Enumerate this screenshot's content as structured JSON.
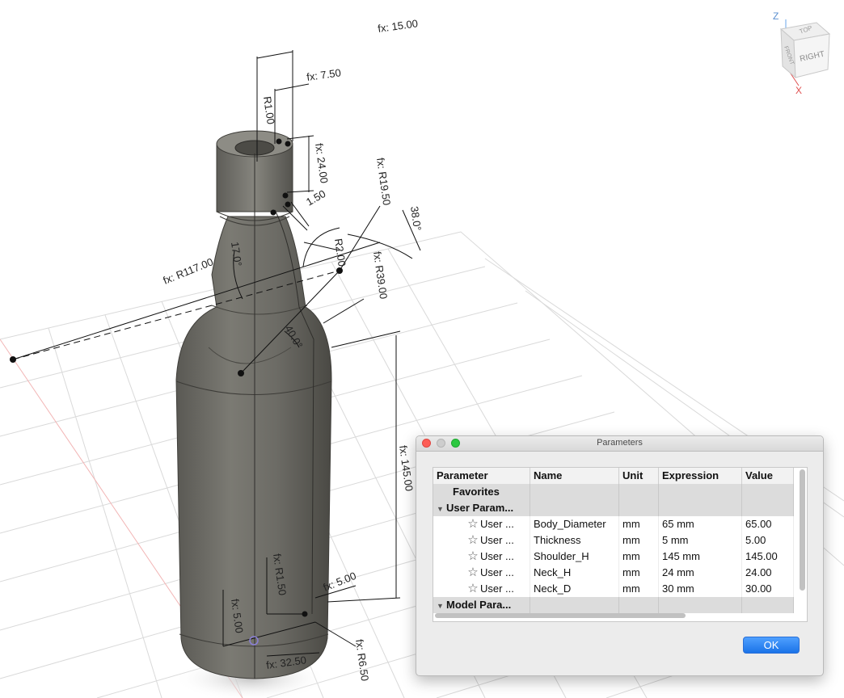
{
  "viewcube": {
    "top_label": "TOP",
    "front_label": "FRONT",
    "right_label": "RIGHT",
    "axis_z": "Z",
    "axis_x": "X"
  },
  "dimensions": {
    "d1": "fx: 15.00",
    "d2": "fx: 7.50",
    "d3": "R1.00",
    "d4": "fx: 24.00",
    "d5": "1.50",
    "d6": "fx: R19.50",
    "d7": "38.0°",
    "d8": "R2.00",
    "d9": "fx: R117.00",
    "d10": "17.0°",
    "d11": "fx: R39.00",
    "d12": "40.0°",
    "d13": "fx: 145.00",
    "d14": "fx: R1.50",
    "d15": "fx: 5.00",
    "d16": "fx: 5.00",
    "d17": "fx: R6.50",
    "d18": "fx: 32.50"
  },
  "dialog": {
    "title": "Parameters",
    "columns": {
      "parameter": "Parameter",
      "name": "Name",
      "unit": "Unit",
      "expression": "Expression",
      "value": "Value"
    },
    "favorites": "Favorites",
    "user_group": "User Param...",
    "model_group": "Model Para...",
    "rows": [
      {
        "param": "User ...",
        "name": "Body_Diameter",
        "unit": "mm",
        "expression": "65 mm",
        "value": "65.00"
      },
      {
        "param": "User ...",
        "name": "Thickness",
        "unit": "mm",
        "expression": "5 mm",
        "value": "5.00"
      },
      {
        "param": "User ...",
        "name": "Shoulder_H",
        "unit": "mm",
        "expression": "145 mm",
        "value": "145.00"
      },
      {
        "param": "User ...",
        "name": "Neck_H",
        "unit": "mm",
        "expression": "24 mm",
        "value": "24.00"
      },
      {
        "param": "User ...",
        "name": "Neck_D",
        "unit": "mm",
        "expression": "30 mm",
        "value": "30.00"
      }
    ],
    "ok_label": "OK"
  }
}
